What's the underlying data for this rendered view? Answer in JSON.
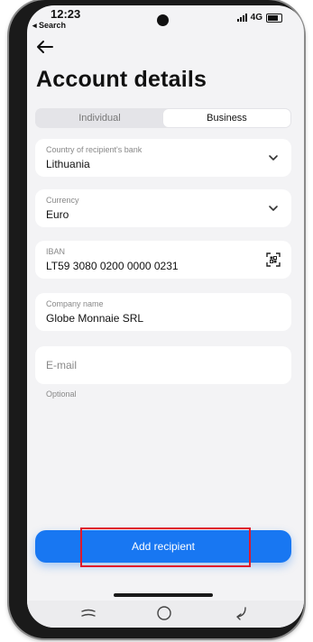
{
  "status_bar": {
    "time": "12:23",
    "back_label": "◂ Search",
    "network": "4G"
  },
  "header": {
    "title": "Account details"
  },
  "tabs": [
    {
      "label": "Individual",
      "active": false
    },
    {
      "label": "Business",
      "active": true
    }
  ],
  "form": {
    "country": {
      "label": "Country of recipient's bank",
      "value": "Lithuania"
    },
    "currency": {
      "label": "Currency",
      "value": "Euro"
    },
    "iban": {
      "label": "IBAN",
      "value": "LT59 3080 0200 0000 0231"
    },
    "company": {
      "label": "Company name",
      "value": "Globe Monnaie SRL"
    },
    "email": {
      "placeholder": "E-mail",
      "hint": "Optional"
    }
  },
  "actions": {
    "add_recipient": "Add recipient"
  },
  "icons": {
    "back": "arrow-left-icon",
    "dropdown": "chevron-down-icon",
    "scan": "qr-scan-icon",
    "nav_recent": "recent-apps-icon",
    "nav_home": "home-icon",
    "nav_back": "back-icon"
  },
  "colors": {
    "accent": "#1877f2",
    "highlight": "#e0192b",
    "background": "#f3f3f5"
  }
}
